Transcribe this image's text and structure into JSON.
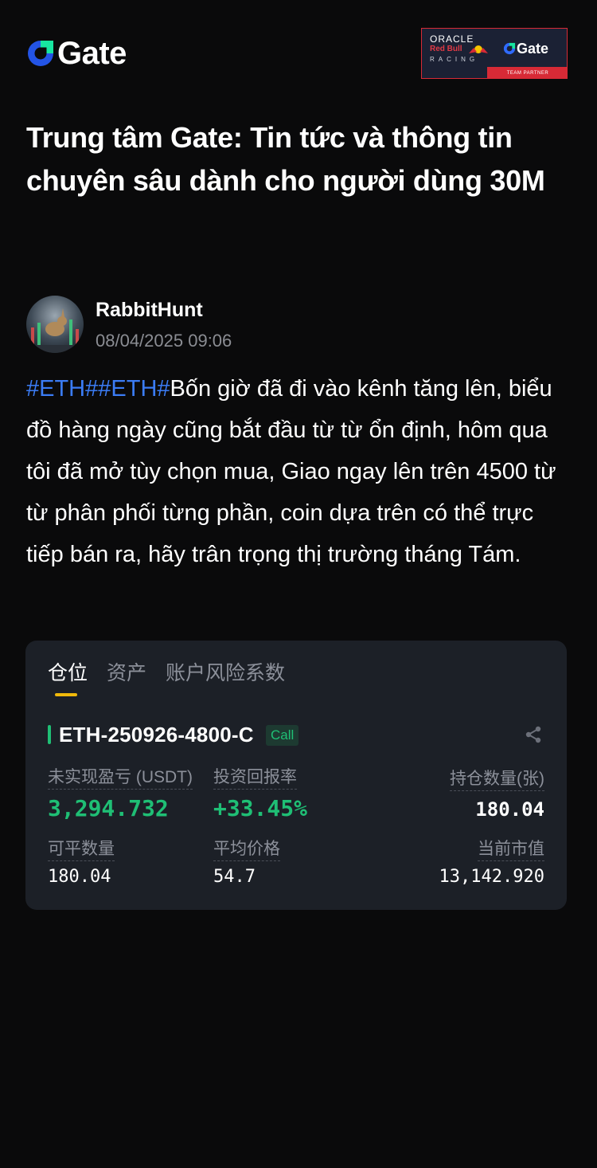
{
  "header": {
    "logo_text": "Gate",
    "partner": {
      "oracle": "ORACLE",
      "redbull": "Red Bull",
      "racing": "RACING",
      "gate_text": "Gate",
      "team_partner": "TEAM PARTNER"
    }
  },
  "page": {
    "title": "Trung tâm Gate: Tin tức và thông tin chuyên sâu dành cho người dùng 30M"
  },
  "post": {
    "author": "RabbitHunt",
    "timestamp": "08/04/2025 09:06",
    "hashtags": "#ETH##ETH#",
    "body": "Bốn giờ đã đi vào kênh tăng lên, biểu đồ hàng ngày cũng bắt đầu từ từ ổn định, hôm qua tôi đã mở tùy chọn mua, Giao ngay lên trên 4500 từ từ phân phối từng phần, coin dựa trên có thể trực tiếp bán ra, hãy trân trọng thị trường tháng Tám."
  },
  "card": {
    "tabs": [
      "仓位",
      "资产",
      "账户风险系数"
    ],
    "contract": "ETH-250926-4800-C",
    "call_label": "Call",
    "unrealized_pnl_label": "未实现盈亏 (USDT)",
    "unrealized_pnl": "3,294.732",
    "roi_label": "投资回报率",
    "roi": "+33.45%",
    "position_qty_label": "持仓数量(张)",
    "position_qty": "180.04",
    "closable_label": "可平数量",
    "closable": "180.04",
    "avg_price_label": "平均价格",
    "avg_price": "54.7",
    "market_value_label": "当前市值",
    "market_value": "13,142.920"
  },
  "colors": {
    "background": "#0a0a0b",
    "hashtag": "#3b7cf5",
    "brand_blue": "#2354e6",
    "positive": "#1fbf75",
    "tab_indicator": "#f0b90b",
    "card_bg": "#1c2027"
  }
}
